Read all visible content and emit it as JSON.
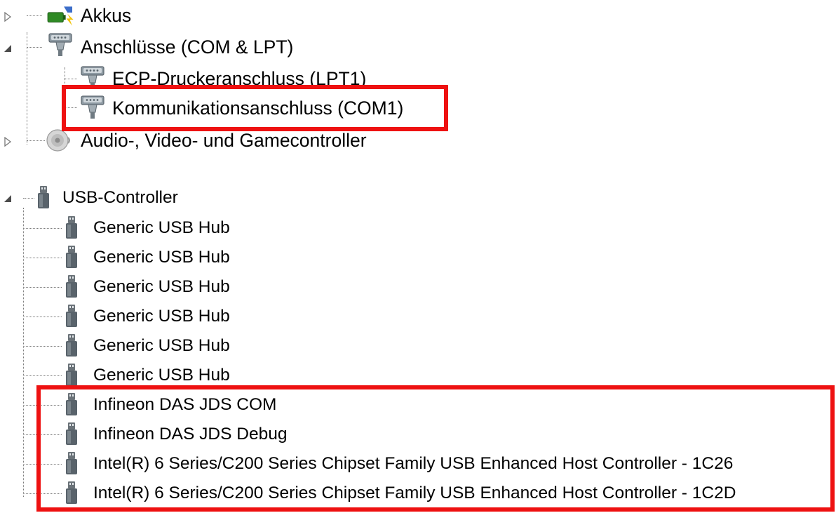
{
  "tree_top": {
    "items": [
      {
        "label": "Akkus",
        "state": "collapsed",
        "icon": "battery-icon"
      },
      {
        "label": "Anschlüsse (COM & LPT)",
        "state": "expanded",
        "icon": "port-connector-icon",
        "children": [
          {
            "label": "ECP-Druckeranschluss (LPT1)",
            "icon": "port-connector-icon"
          },
          {
            "label": "Kommunikationsanschluss (COM1)",
            "icon": "port-connector-icon",
            "highlighted": true
          }
        ]
      },
      {
        "label": "Audio-, Video- und Gamecontroller",
        "state": "collapsed",
        "icon": "speaker-icon"
      }
    ]
  },
  "tree_usb": {
    "category": {
      "label": "USB-Controller",
      "state": "expanded",
      "icon": "usb-plug-icon"
    },
    "children": [
      {
        "label": "Generic USB Hub"
      },
      {
        "label": "Generic USB Hub"
      },
      {
        "label": "Generic USB Hub"
      },
      {
        "label": "Generic USB Hub"
      },
      {
        "label": "Generic USB Hub"
      },
      {
        "label": "Generic USB Hub"
      },
      {
        "label": "Infineon DAS JDS COM",
        "highlighted": true
      },
      {
        "label": "Infineon DAS JDS Debug",
        "highlighted": true
      },
      {
        "label": "Intel(R) 6 Series/C200 Series Chipset Family USB Enhanced Host Controller - 1C26",
        "highlighted": true
      },
      {
        "label": "Intel(R) 6 Series/C200 Series Chipset Family USB Enhanced Host Controller - 1C2D",
        "highlighted": true
      }
    ]
  },
  "colors": {
    "highlight": "#ee1111",
    "tree_line": "#7a7a7a",
    "expander": "#595959"
  }
}
